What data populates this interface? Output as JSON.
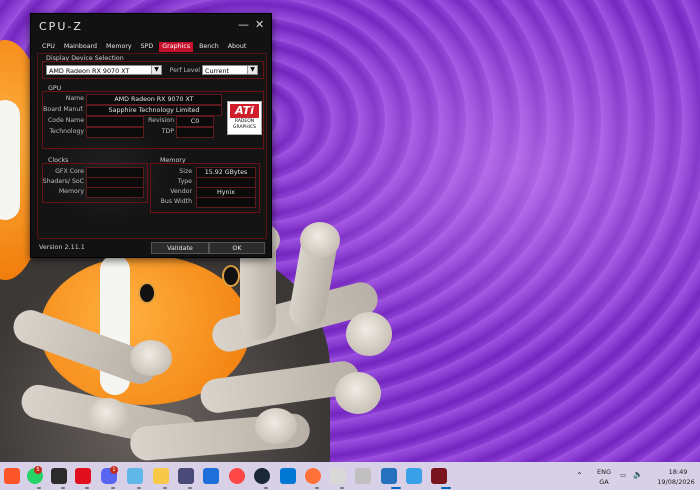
{
  "cpuz": {
    "title": "CPU-Z",
    "tabs": [
      "CPU",
      "Mainboard",
      "Memory",
      "SPD",
      "Graphics",
      "Bench",
      "About"
    ],
    "active_tab": "Graphics",
    "display_selection": {
      "group_label": "Display Device Selection",
      "device": "AMD Radeon RX 9070 XT",
      "perf_level_label": "Perf Level",
      "perf_level": "Current"
    },
    "gpu": {
      "group_label": "GPU",
      "name_label": "Name",
      "name": "AMD Radeon RX 9070 XT",
      "board_manuf_label": "Board Manuf.",
      "board_manuf": "Sapphire Technology Limited",
      "code_name_label": "Code Name",
      "code_name": "",
      "revision_label": "Revision",
      "revision": "C0",
      "technology_label": "Technology",
      "technology": "",
      "tdp_label": "TDP",
      "tdp": ""
    },
    "logo": {
      "brand": "ATi",
      "line2": "RADEON",
      "line3": "GRAPHICS"
    },
    "clocks": {
      "group_label": "Clocks",
      "gfx_core_label": "GFX Core",
      "gfx_core": "",
      "shaders_label": "Shaders/ SoC",
      "shaders": "",
      "memory_label": "Memory",
      "memory": ""
    },
    "memory": {
      "group_label": "Memory",
      "size_label": "Size",
      "size": "15.92 GBytes",
      "type_label": "Type",
      "type": "",
      "vendor_label": "Vendor",
      "vendor": "Hynix",
      "bus_width_label": "Bus Width",
      "bus_width": ""
    },
    "version": "Version 2.11.1",
    "validate_label": "Validate",
    "ok_label": "OK",
    "accent_color": "#c5102c"
  },
  "taskbar": {
    "apps": [
      "brave-icon",
      "whatsapp-icon",
      "terminal-icon",
      "amd-software-icon",
      "discord-icon",
      "notepad-icon",
      "file-explorer-icon",
      "calculator-icon",
      "shield-icon",
      "ea-app-icon",
      "steam-icon",
      "vscode-icon",
      "firefox-icon",
      "app-icon",
      "snipping-icon",
      "powershell-icon",
      "photos-icon",
      "cpuz-icon"
    ],
    "whatsapp_badge": "5",
    "discord_badge": "1",
    "lang_line1": "ENG",
    "lang_line2": "GA",
    "time": "18:49",
    "date": "19/08/2026"
  }
}
